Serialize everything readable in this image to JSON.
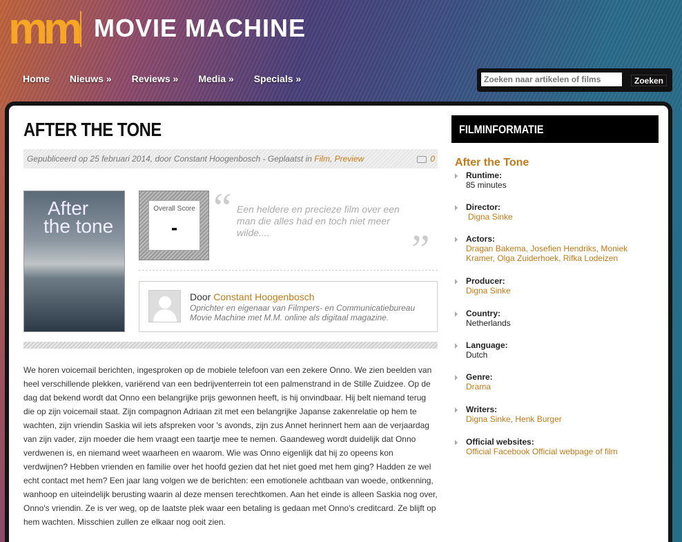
{
  "site": {
    "logo_mark": "m",
    "logo_text": "MOVIE MACHINE"
  },
  "nav": [
    "Home",
    "Nieuws »",
    "Reviews »",
    "Media »",
    "Specials »"
  ],
  "search": {
    "placeholder": "Zoeken naar artikelen of films",
    "button": "Zoeken"
  },
  "article": {
    "title": "AFTER THE TONE",
    "meta_prefix": "Gepubliceerd op 25 februari 2014, door Constant Hoogenbosch - Geplaatst in ",
    "category1": "Film",
    "meta_sep": ", ",
    "category2": "Preview",
    "comments": "0",
    "poster_title_line1": "After",
    "poster_title_line2": "the tone",
    "score_label": "Overall Score",
    "score_value": "-",
    "quote": "Een heldere en precieze film over een man die alles had en toch niet meer wilde....",
    "author_prefix": "Door ",
    "author_name": "Constant Hoogenbosch",
    "author_bio": "Oprichter en eigenaar van Filmpers- en Communicatiebureau Movie Machine met M.M. online als digitaal magazine.",
    "body": "We horen voicemail berichten, ingesproken op de mobiele telefoon van een zekere Onno. We zien beelden van heel verschillende plekken, variërend van een bedrijventerrein tot een palmenstrand in de Stille Zuidzee. Op de dag dat bekend wordt dat Onno een belangrijke prijs gewonnen heeft, is hij onvindbaar. Hij belt niemand terug die op zijn voicemail staat. Zijn compagnon Adriaan zit met een belangrijke Japanse zakenrelatie op hem te wachten, zijn vriendin Saskia wil iets afspreken voor 's avonds, zijn zus Annet herinnert hem aan de verjaardag van zijn vader, zijn moeder die hem vraagt een taartje mee te nemen. Gaandeweg wordt duidelijk dat Onno verdwenen is, en niemand weet waarheen en waarom. Wie was Onno eigenlijk dat hij zo opeens kon verdwijnen? Hebben vrienden en familie over het hoofd gezien dat het niet goed met hem ging? Hadden ze wel echt contact met hem? Een jaar lang volgen we de berichten: een emotionele achtbaan van woede, ontkenning, wanhoop en uiteindelijk berusting waarin al deze mensen terechtkomen. Aan het einde is alleen Saskia nog over, Onno's vriendin. Ze is ver weg, op de laatste plek waar een betaling is gedaan met Onno's creditcard. Ze blijft op hem wachten. Misschien zullen ze elkaar nog ooit zien."
  },
  "sidebar": {
    "heading": "FILMINFORMATIE",
    "film_title": "After the Tone",
    "runtime_label": "Runtime:",
    "runtime": "85 minutes",
    "director_label": "Director:",
    "director": "Digna Sinke",
    "actors_label": "Actors:",
    "actors": "Dragan Bakema, Josefien Hendriks, Moniek Kramer, Olga Zuiderhoek, Rifka Lodeizen",
    "producer_label": "Producer:",
    "producer": "Digna Sinke",
    "country_label": "Country:",
    "country": "Netherlands",
    "language_label": "Language:",
    "language": "Dutch",
    "genre_label": "Genre:",
    "genre": "Drama",
    "writers_label": "Writers:",
    "writers": "Digna Sinke, Henk Burger",
    "websites_label": "Official websites:",
    "websites": "Official Facebook Official webpage of film"
  },
  "colors": {
    "accent": "#c27a17",
    "logo": "#f5a623",
    "panel_border": "#141414"
  }
}
